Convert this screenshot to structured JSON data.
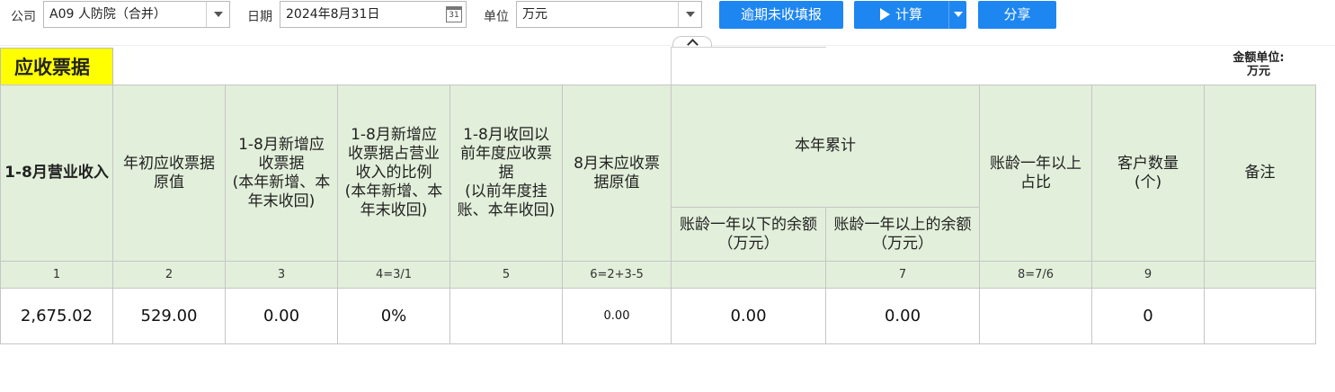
{
  "toolbar": {
    "company_label": "公司",
    "company_value": "A09 人防院（合并）",
    "date_label": "日期",
    "date_value": "2024年8月31日",
    "calendar_glyph": "31",
    "unit_label": "单位",
    "unit_value": "万元",
    "overdue_button": "逾期未收填报",
    "calc_button": "计算",
    "share_button": "分享"
  },
  "report": {
    "title": "应收票据",
    "unit_note_line1": "金额单位:",
    "unit_note_line2": "万元"
  },
  "table": {
    "headers": {
      "c1": "1-8月营业收入",
      "c2": "年初应收票据原值",
      "c3": "1-8月新增应收票据\n(本年新增、本年末收回)",
      "c4": "1-8月新增应收票据占营业收入的比例\n(本年新增、本年末收回)",
      "c5": "1-8月收回以前年度应收票据\n(以前年度挂账、本年收回)",
      "c6": "8月末应收票据原值",
      "group": "本年累计",
      "c7a": "账龄一年以下的余额（万元）",
      "c7b": "账龄一年以上的余额（万元）",
      "c8": "账龄一年以上占比",
      "c9": "客户数量\n(个)",
      "c10": "备注"
    },
    "index_row": [
      "1",
      "2",
      "3",
      "4=3/1",
      "5",
      "6=2+3-5",
      "",
      "7",
      "8=7/6",
      "9",
      ""
    ],
    "data_row": [
      "2,675.02",
      "529.00",
      "0.00",
      "0%",
      "",
      "0.00",
      "0.00",
      "0.00",
      "",
      "0",
      ""
    ]
  }
}
